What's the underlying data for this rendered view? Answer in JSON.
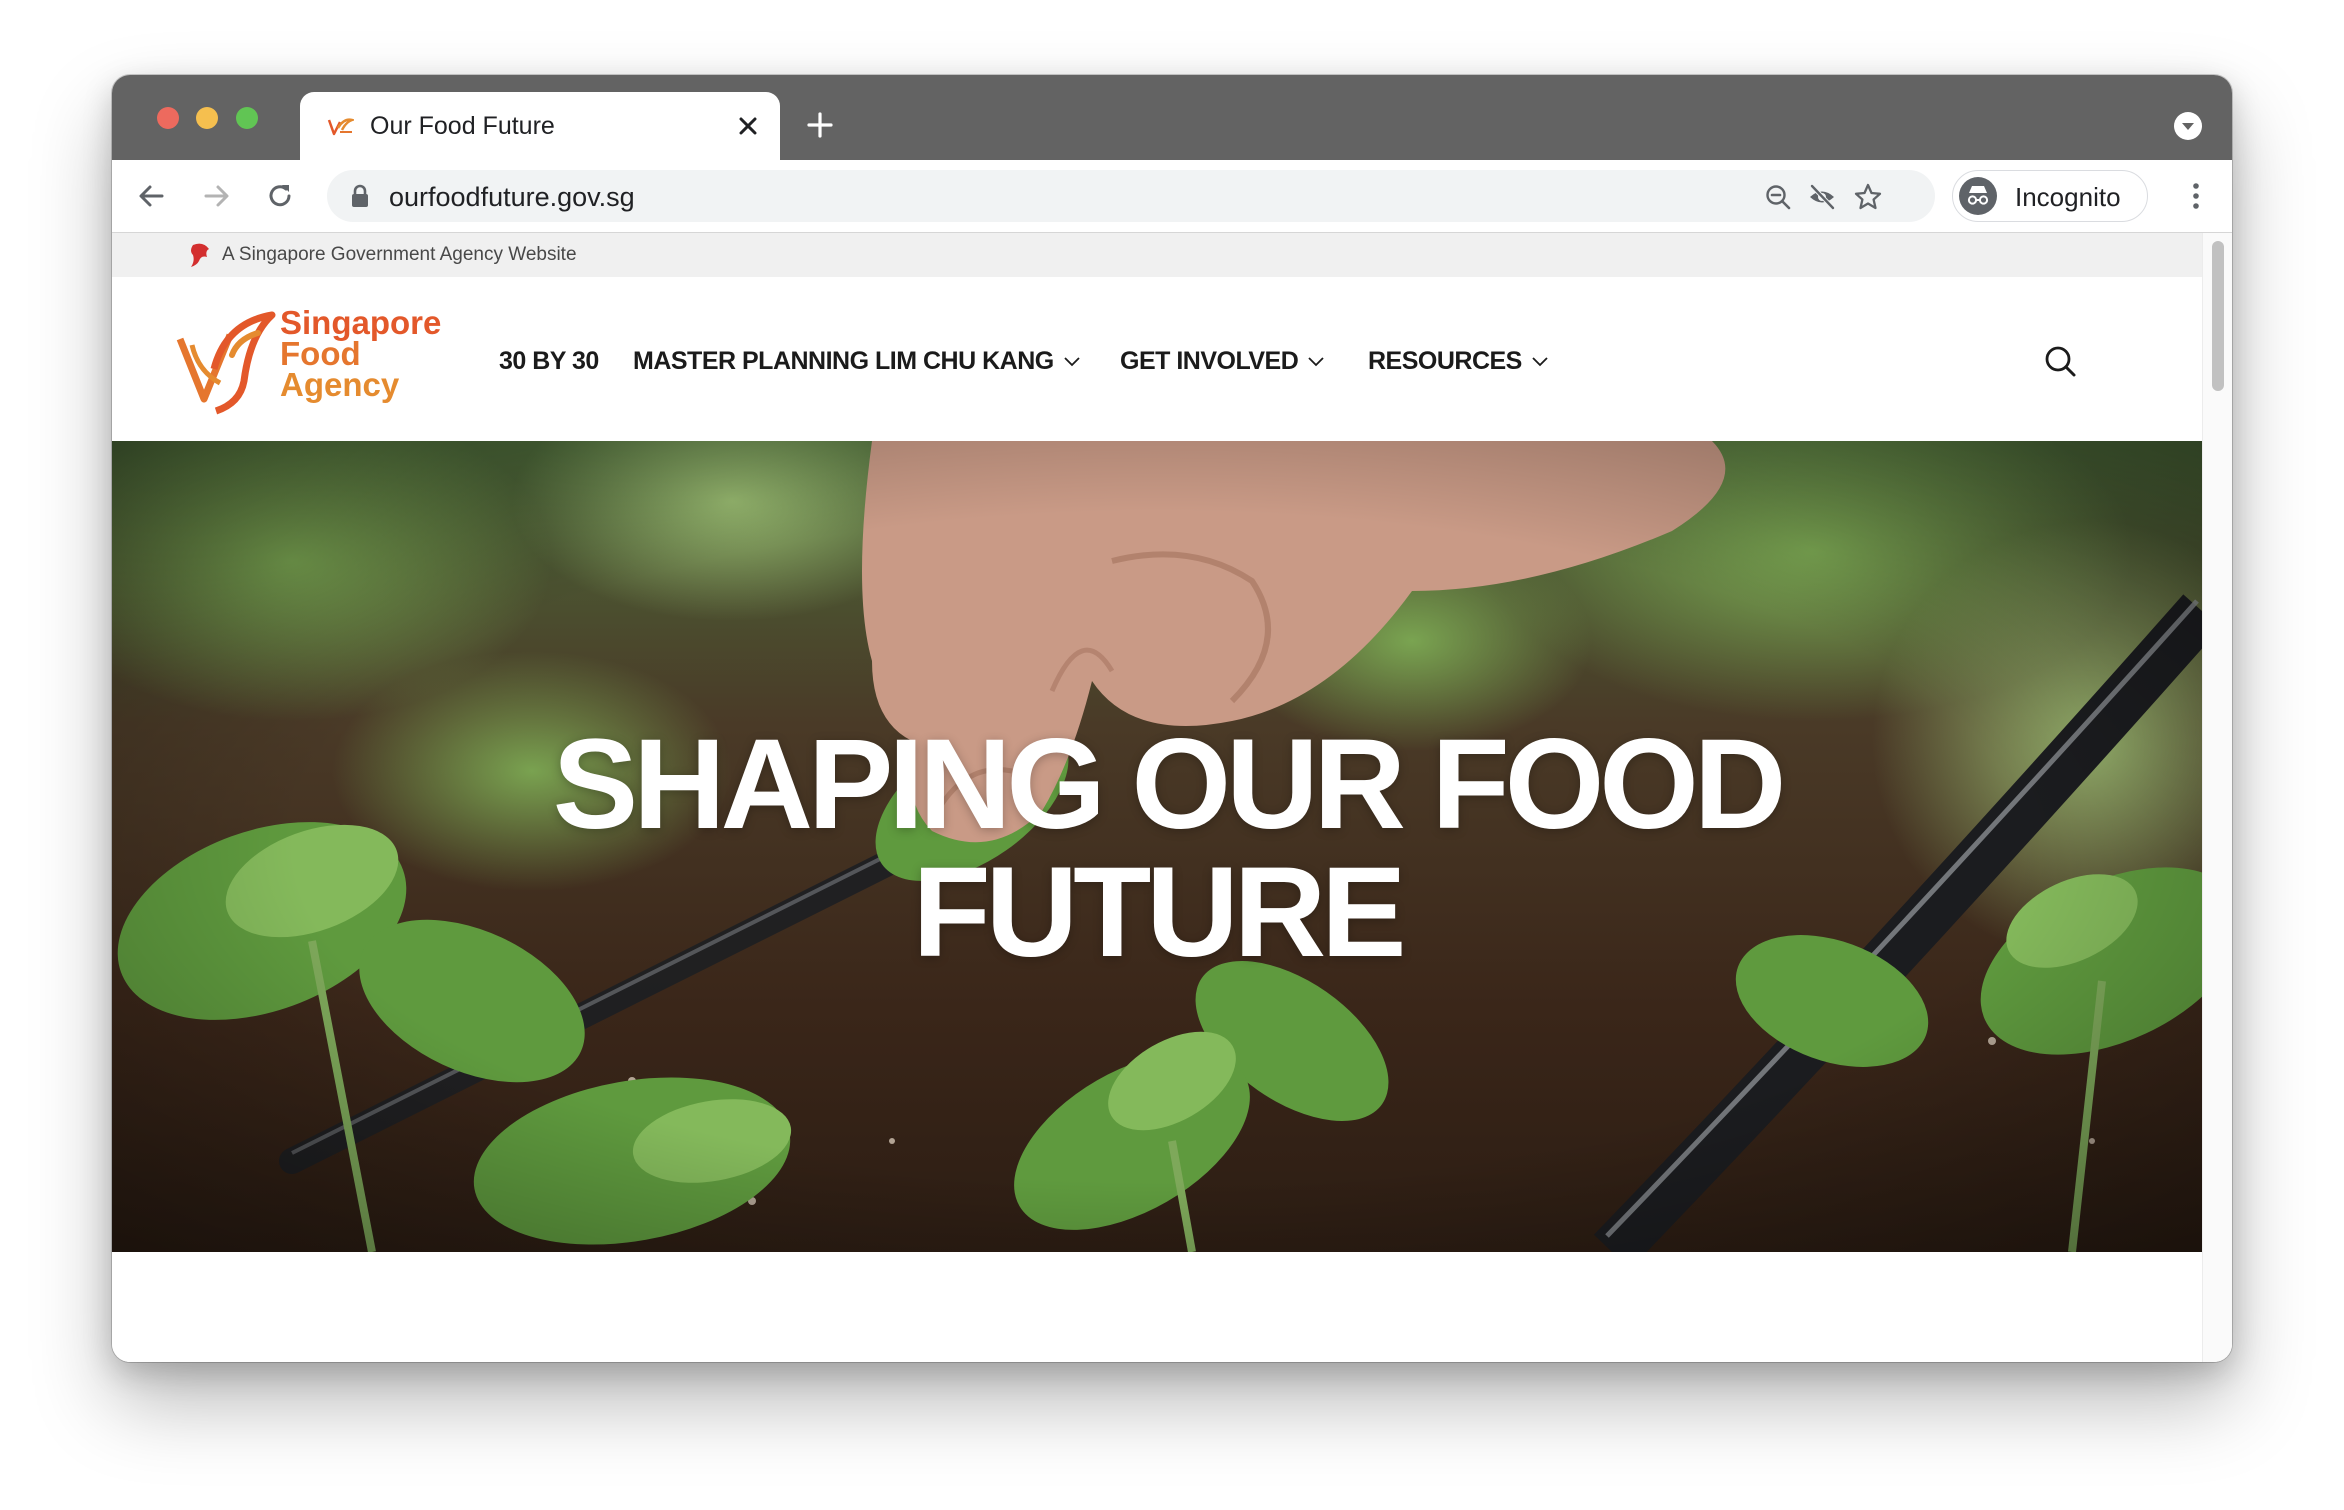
{
  "browser": {
    "tab_title": "Our Food Future",
    "url": "ourfoodfuture.gov.sg",
    "profile_label": "Incognito",
    "colors": {
      "tabstrip": "#636363",
      "close_red": "#ed6a5e",
      "minimize_yellow": "#f5bf4f",
      "maximize_green": "#61c554"
    }
  },
  "page": {
    "gov_banner": "A Singapore Government Agency Website",
    "logo": {
      "line1": "Singapore",
      "line2": "Food",
      "line3": "Agency"
    },
    "nav": [
      {
        "label": "30 BY 30",
        "has_dropdown": false
      },
      {
        "label": "MASTER PLANNING LIM CHU KANG",
        "has_dropdown": true
      },
      {
        "label": "GET INVOLVED",
        "has_dropdown": true
      },
      {
        "label": "RESOURCES",
        "has_dropdown": true
      }
    ],
    "hero": {
      "title_line1": "SHAPING OUR FOOD",
      "title_line2": "FUTURE"
    },
    "colors": {
      "brand_orange": "#e37b30",
      "brand_red": "#e3582a",
      "nav_text": "#1b1b1b"
    }
  }
}
